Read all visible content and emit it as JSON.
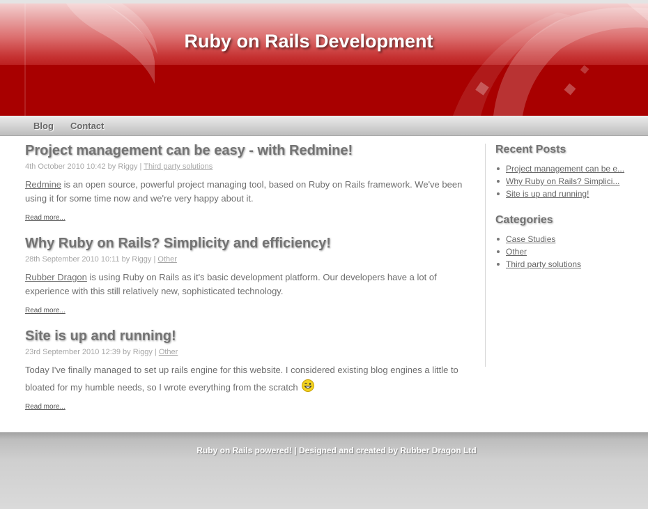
{
  "header": {
    "title": "Ruby on Rails Development"
  },
  "nav": {
    "items": [
      "Blog",
      "Contact"
    ]
  },
  "posts": [
    {
      "title": "Project management can be easy - with Redmine!",
      "meta_prefix": "4th October 2010 10:42 by Riggy | ",
      "category": "Third party solutions",
      "link_text": "Redmine",
      "body_rest": " is an open source, powerful project managing tool, based on Ruby on Rails framework. We've been using it for some time now and we're very happy about it.",
      "read_more": "Read more..."
    },
    {
      "title": "Why Ruby on Rails? Simplicity and efficiency!",
      "meta_prefix": "28th September 2010 10:11 by Riggy | ",
      "category": "Other",
      "link_text": "Rubber Dragon",
      "body_rest": " is using Ruby on Rails as it's basic development platform. Our developers have a lot of experience with this still relatively new, sophisticated technology.",
      "read_more": "Read more..."
    },
    {
      "title": "Site is up and running!",
      "meta_prefix": "23rd September 2010 12:39 by Riggy | ",
      "category": "Other",
      "body": "Today I've finally managed to set up rails engine for this website. I considered existing blog engines a little to bloated for my humble needs, so I wrote everything from the scratch",
      "read_more": "Read more..."
    }
  ],
  "sidebar": {
    "recent_title": "Recent Posts",
    "recent": [
      "Project management can be e...",
      "Why Ruby on Rails? Simplici...",
      "Site is up and running!"
    ],
    "categories_title": "Categories",
    "categories": [
      "Case Studies",
      "Other",
      "Third party solutions"
    ]
  },
  "footer": {
    "text": "Ruby on Rails powered! | Designed and created by Rubber Dragon Ltd"
  },
  "colors": {
    "header_red": "#a80000",
    "text_gray": "#6e6e6e",
    "title_gray": "#737373"
  }
}
